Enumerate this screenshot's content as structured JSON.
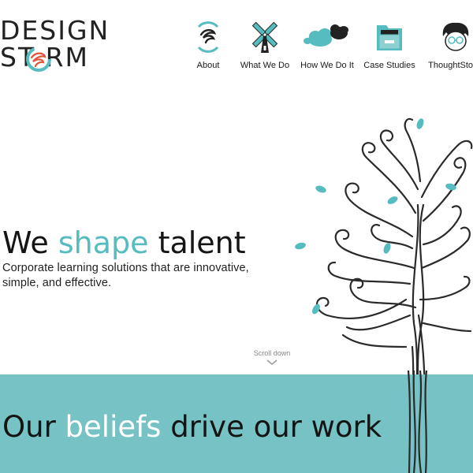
{
  "brand": {
    "logo_top": "DESIGN",
    "logo_bottom": "ST RM"
  },
  "nav": {
    "items": [
      {
        "label": "About",
        "icon": "swirl-icon"
      },
      {
        "label": "What We Do",
        "icon": "windmill-icon"
      },
      {
        "label": "How We Do It",
        "icon": "cloud-icon"
      },
      {
        "label": "Case Studies",
        "icon": "folder-icon"
      },
      {
        "label": "ThoughtStorm",
        "icon": "face-icon"
      }
    ]
  },
  "hero": {
    "title_before": "We ",
    "title_accent": "shape",
    "title_after": " talent",
    "subtitle": "Corporate learning solutions that are innovative, simple, and effective."
  },
  "scroll": {
    "label": "Scroll down"
  },
  "beliefs": {
    "before": "Our ",
    "accent": "beliefs",
    "after": " drive our work"
  },
  "colors": {
    "accent": "#56bcbf",
    "band": "#77c2c4",
    "dark": "#1a1a1a"
  }
}
